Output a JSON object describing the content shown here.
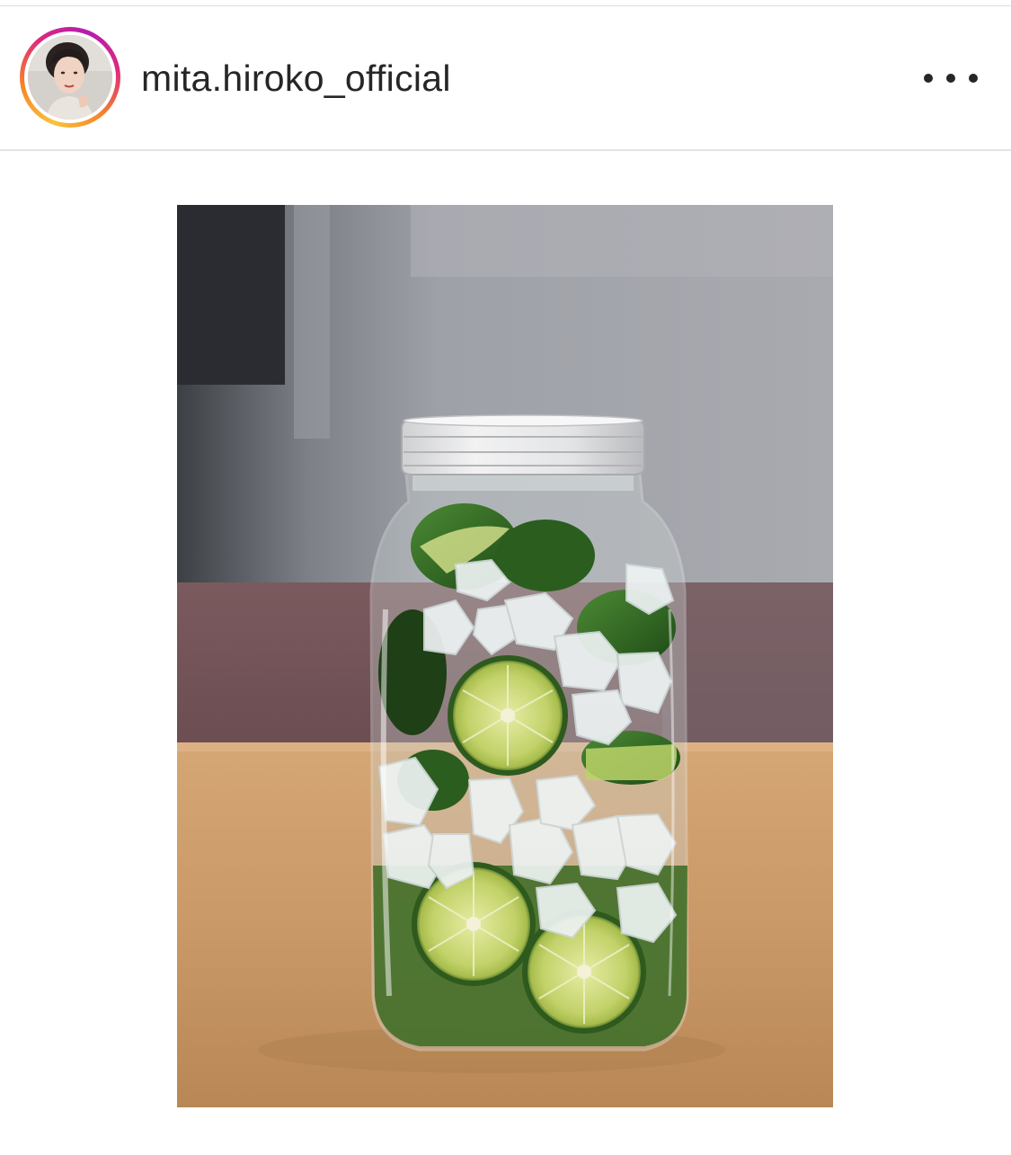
{
  "post": {
    "username": "mita.hiroko_official",
    "avatar_icon": "profile-photo-avatar",
    "more_icon": "more-options-icon",
    "story_ring_colors": [
      "#f9c33b",
      "#f58529",
      "#dd2a7b",
      "#b41cb2"
    ],
    "photo_subject": "glass jar with sudachi citrus slices and rock sugar"
  }
}
